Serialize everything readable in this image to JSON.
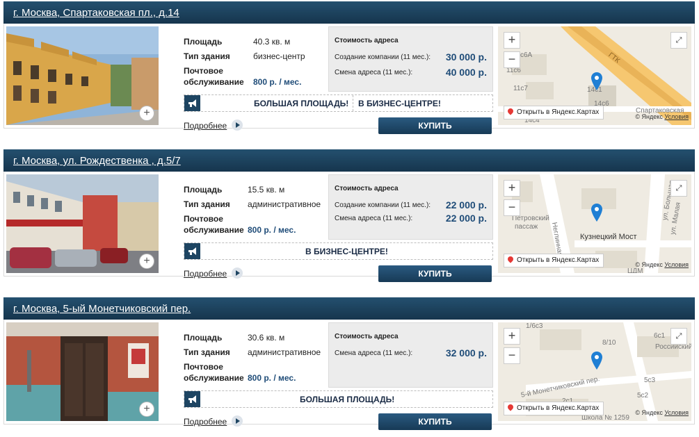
{
  "listings": [
    {
      "address": "г. Москва, Спартаковская пл., д.14",
      "props": [
        {
          "label": "Площадь",
          "value": "40.3 кв. м"
        },
        {
          "label": "Тип здания",
          "value": "бизнес-центр"
        },
        {
          "label": "Почтовое",
          "label2": "обслуживание",
          "value": "800 р. / мес."
        }
      ],
      "price_title": "Стоимость адреса",
      "prices": [
        {
          "label": "Создание компании (11 мес.):",
          "value": "30 000 р."
        },
        {
          "label": "Смена адреса (11 мес.):",
          "value": "40 000 р."
        }
      ],
      "badges": [
        "БОЛЬШАЯ ПЛОЩАДЬ!",
        "В БИЗНЕС-ЦЕНТРЕ!"
      ],
      "more": "Подробнее",
      "buy": "КУПИТЬ",
      "map": {
        "open": "Открыть в Яндекс.Картах",
        "copyright": "© Яндекс",
        "terms": "Условия",
        "labels": [
          "с6А",
          "11с6",
          "11с7",
          "14с1",
          "14с6",
          "ГТК",
          "Спартаковская",
          "14с4"
        ]
      }
    },
    {
      "address": "г. Москва, ул. Рождественка , д.5/7",
      "props": [
        {
          "label": "Площадь",
          "value": "15.5 кв. м"
        },
        {
          "label": "Тип здания",
          "value": "административное"
        },
        {
          "label": "Почтовое",
          "label2": "обслуживание",
          "value": "800 р. / мес."
        }
      ],
      "price_title": "Стоимость адреса",
      "prices": [
        {
          "label": "Создание компании (11 мес.):",
          "value": "22 000 р."
        },
        {
          "label": "Смена адреса (11 мес.):",
          "value": "22 000 р."
        }
      ],
      "badges": [
        "В БИЗНЕС-ЦЕНТРЕ!"
      ],
      "more": "Подробнее",
      "buy": "КУПИТЬ",
      "map": {
        "open": "Открыть в Яндекс.Картах",
        "copyright": "© Яндекс",
        "terms": "Условия",
        "labels": [
          "Петровский",
          "пассаж",
          "Неглинная",
          "Кузнецкий Мост",
          "ул. Большая",
          "ул. Малая",
          "ЦДМ"
        ]
      }
    },
    {
      "address": "г. Москва, 5-ый Монетчиковский пер.",
      "props": [
        {
          "label": "Площадь",
          "value": "30.6 кв. м"
        },
        {
          "label": "Тип здания",
          "value": "административное"
        },
        {
          "label": "Почтовое",
          "label2": "обслуживание",
          "value": "800 р. / мес."
        }
      ],
      "price_title": "Стоимость адреса",
      "prices": [
        {
          "label": "Смена адреса (11 мес.):",
          "value": "32 000 р."
        }
      ],
      "badges": [
        "БОЛЬШАЯ ПЛОЩАДЬ!"
      ],
      "more": "Подробнее",
      "buy": "КУПИТЬ",
      "map": {
        "open": "Открыть в Яндекс.Картах",
        "copyright": "© Яндекс",
        "terms": "Условия",
        "labels": [
          "1/6с3",
          "6с1",
          "Российский",
          "8/10",
          "5-й Монетчиковский пер.",
          "5с3",
          "5с2",
          "2с1",
          "Школа № 1259"
        ]
      }
    }
  ],
  "icons": {
    "plus": "+",
    "zoom_in": "+",
    "zoom_out": "−",
    "expand": "⤢",
    "arrow": "play-icon"
  }
}
